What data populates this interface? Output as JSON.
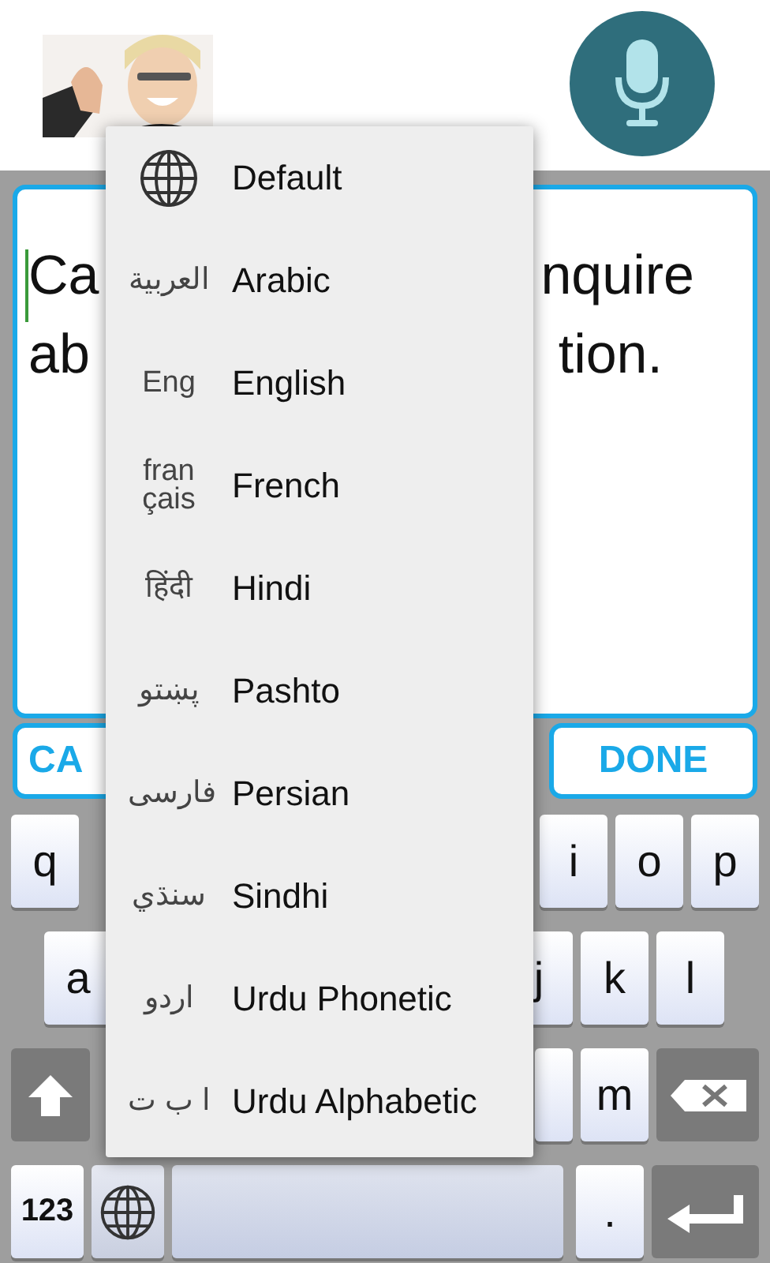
{
  "editor": {
    "lines": [
      {
        "start": "Ca",
        "end": "nquire"
      },
      {
        "start": "ab",
        "end": "tion."
      }
    ]
  },
  "actions": [
    {
      "label": "CA"
    },
    {
      "label": "DONE"
    }
  ],
  "keyboard": {
    "rows": [
      {
        "left": [
          {
            "kind": "letter",
            "label": "q"
          }
        ],
        "right": [
          {
            "kind": "letter",
            "label": "i"
          },
          {
            "kind": "letter",
            "label": "o"
          },
          {
            "kind": "letter",
            "label": "p"
          }
        ]
      },
      {
        "left": [
          {
            "kind": "letter",
            "label": "a"
          }
        ],
        "right": [
          {
            "kind": "letter",
            "label": "j"
          },
          {
            "kind": "letter",
            "label": "k"
          },
          {
            "kind": "letter",
            "label": "l"
          }
        ]
      },
      {
        "left": [
          {
            "kind": "shift"
          }
        ],
        "right": [
          {
            "kind": "blank"
          },
          {
            "kind": "letter",
            "label": "m"
          },
          {
            "kind": "backspace"
          }
        ]
      },
      {
        "left": [
          {
            "kind": "text",
            "label": "123"
          },
          {
            "kind": "globe"
          },
          {
            "kind": "space"
          }
        ],
        "right": [
          {
            "kind": "letter",
            "label": "."
          },
          {
            "kind": "enter"
          }
        ]
      }
    ]
  },
  "language_menu": {
    "items": [
      {
        "label": "Default",
        "kind": "globe"
      },
      {
        "label": "Arabic",
        "script": "العربية"
      },
      {
        "label": "English",
        "script": "Eng"
      },
      {
        "label": "French",
        "script": "fran çais"
      },
      {
        "label": "Hindi",
        "script": "हिंदी"
      },
      {
        "label": "Pashto",
        "script": "پښتو"
      },
      {
        "label": "Persian",
        "script": "فارسی"
      },
      {
        "label": "Sindhi",
        "script": "سنڌي"
      },
      {
        "label": "Urdu Phonetic",
        "script": "اردو"
      },
      {
        "label": "Urdu Alphabetic",
        "script": "ا ب ت"
      }
    ]
  }
}
